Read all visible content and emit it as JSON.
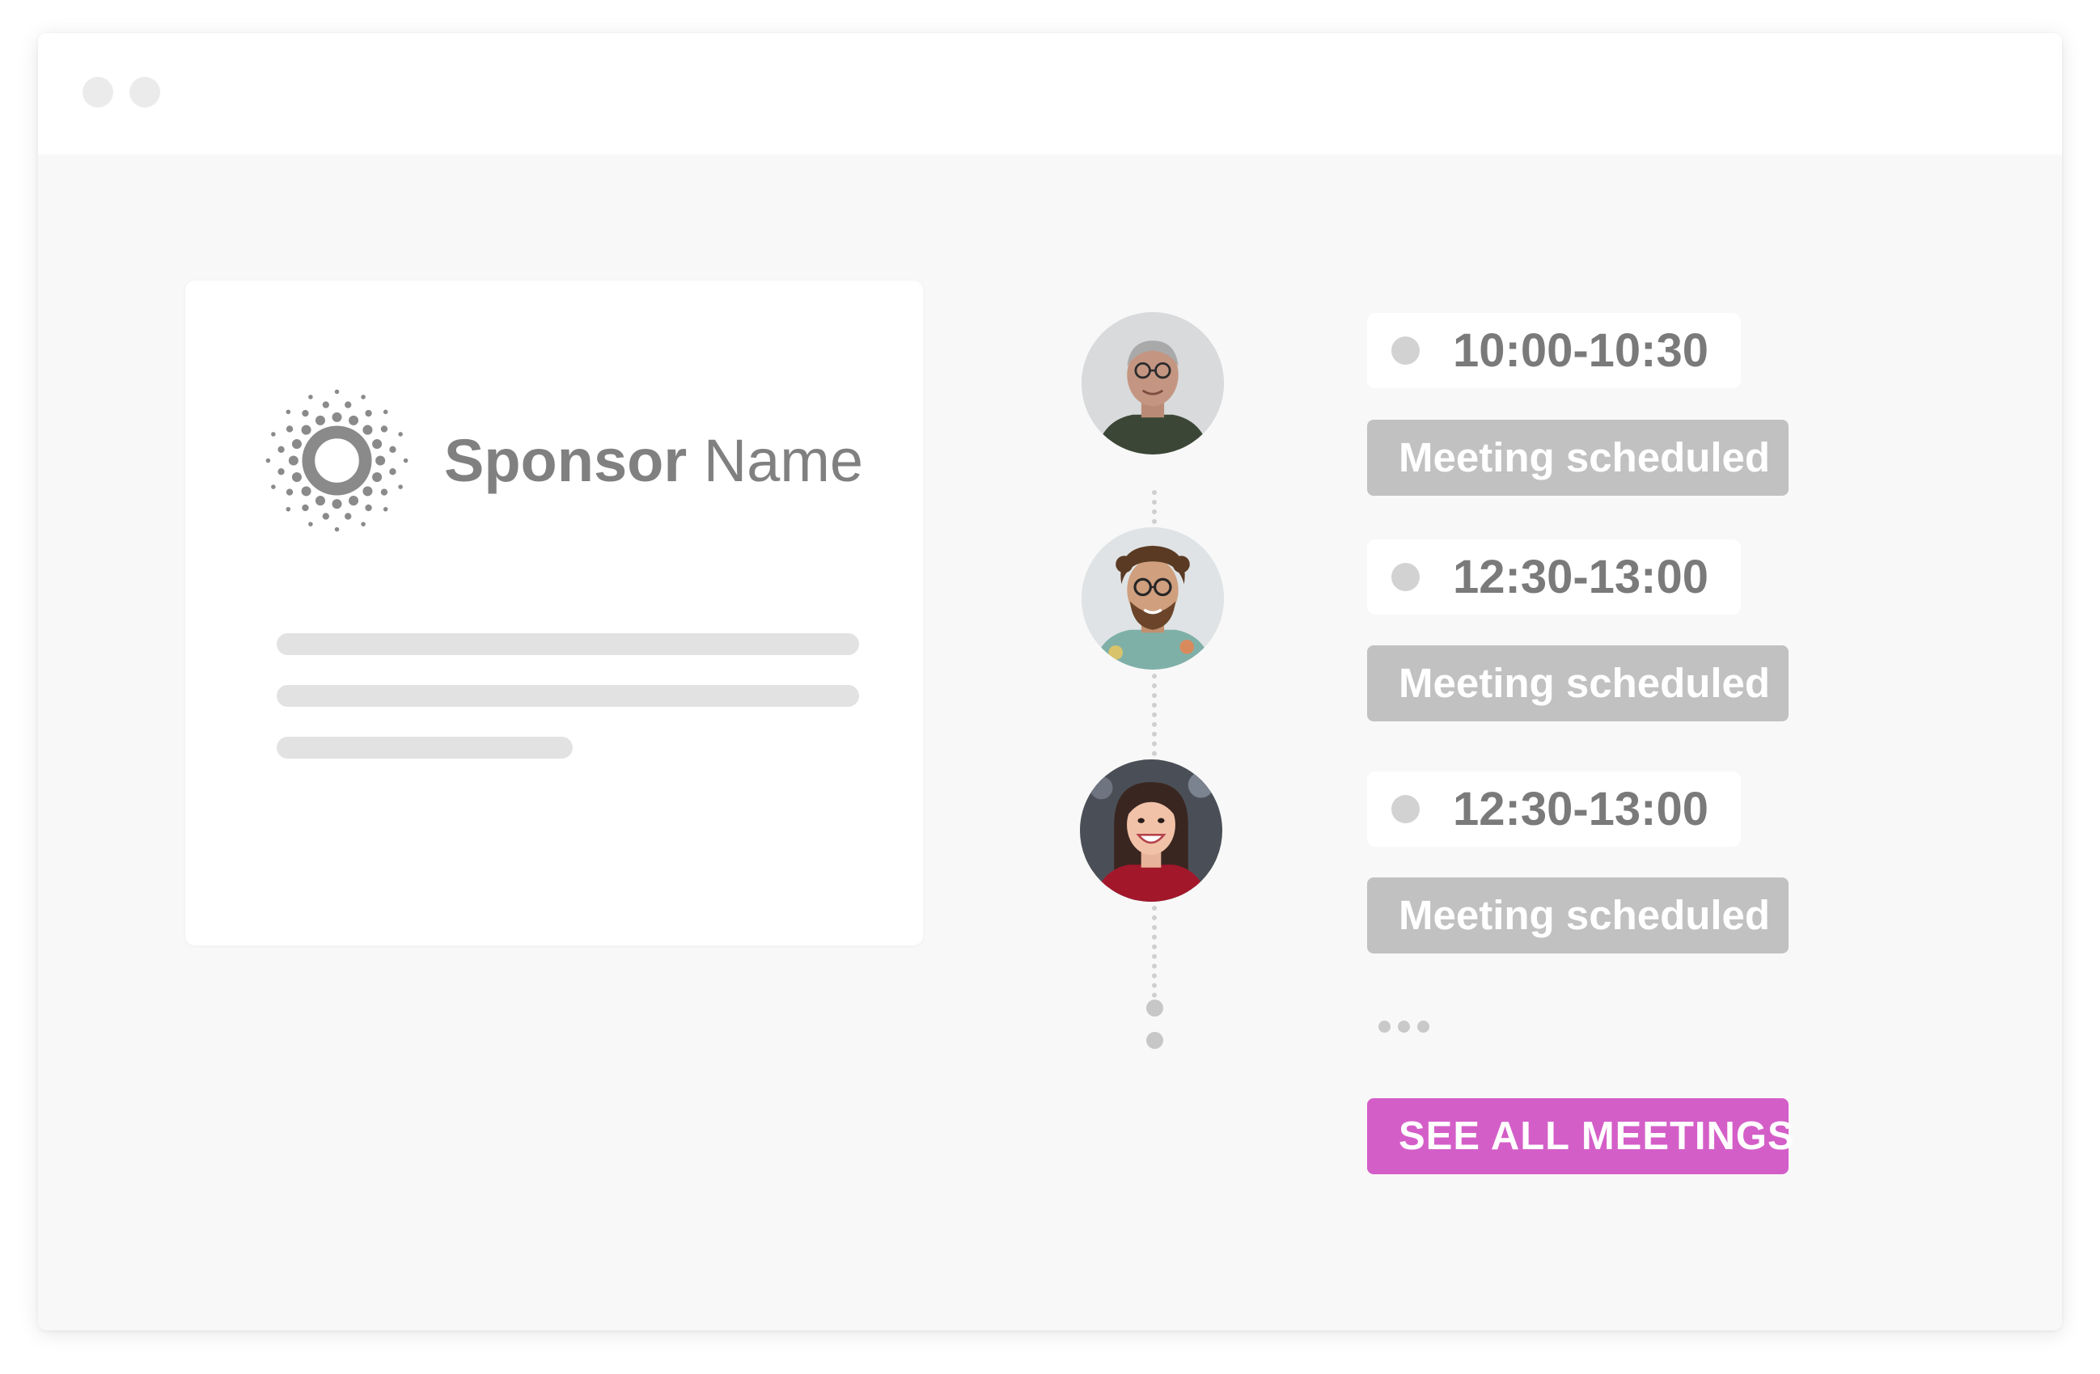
{
  "window": {
    "controls": [
      "window-dot",
      "window-dot"
    ]
  },
  "sponsor": {
    "name_bold": "Sponsor",
    "name_regular": "Name",
    "logo_icon": "sunburst-logo-icon"
  },
  "meetings": [
    {
      "avatar": "person-glasses-gray-hair-avatar",
      "time": "10:00-10:30",
      "status": "Meeting scheduled"
    },
    {
      "avatar": "person-curly-hair-beard-avatar",
      "time": "12:30-13:00",
      "status": "Meeting scheduled"
    },
    {
      "avatar": "person-dark-hair-smiling-avatar",
      "time": "12:30-13:00",
      "status": "Meeting scheduled"
    }
  ],
  "more_indicator": "more-ellipsis-icon",
  "see_all_button": "SEE ALL MEETINGS",
  "colors": {
    "accent": "#d45ec8",
    "status_button": "#c1c1c1",
    "time_text": "#7a7a7a",
    "sponsor_text": "#808080",
    "canvas": "#f8f8f8"
  }
}
